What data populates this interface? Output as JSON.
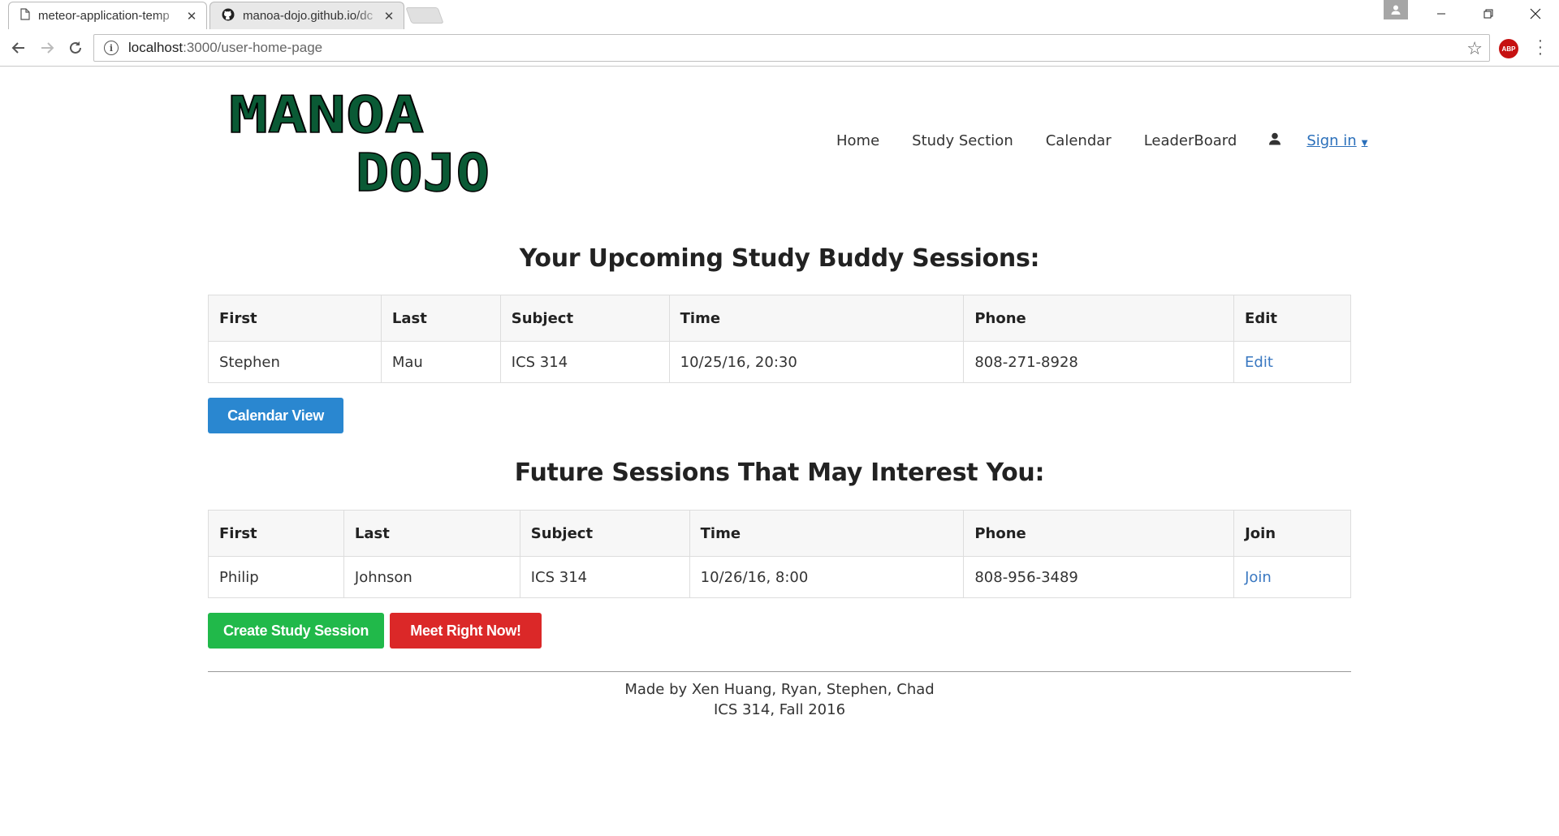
{
  "browser": {
    "tabs": [
      {
        "title": "meteor-application-temp",
        "icon": "page-icon",
        "active": true
      },
      {
        "title": "manoa-dojo.github.io/dc",
        "icon": "github-icon",
        "active": false
      }
    ],
    "url": {
      "host": "localhost",
      "path": ":3000/user-home-page"
    }
  },
  "header": {
    "logo": {
      "line1": "MANOA",
      "line2": "DOJO",
      "color": "#0a5a35"
    },
    "nav": {
      "home": "Home",
      "study_section": "Study Section",
      "calendar": "Calendar",
      "leaderboard": "LeaderBoard",
      "signin": "Sign in"
    }
  },
  "upcoming": {
    "title": "Your Upcoming Study Buddy Sessions:",
    "columns": [
      "First",
      "Last",
      "Subject",
      "Time",
      "Phone",
      "Edit"
    ],
    "rows": [
      {
        "first": "Stephen",
        "last": "Mau",
        "subject": "ICS 314",
        "time": "10/25/16, 20:30",
        "phone": "808-271-8928",
        "action": "Edit"
      }
    ],
    "button": "Calendar View"
  },
  "future": {
    "title": "Future Sessions That May Interest You:",
    "columns": [
      "First",
      "Last",
      "Subject",
      "Time",
      "Phone",
      "Join"
    ],
    "rows": [
      {
        "first": "Philip",
        "last": "Johnson",
        "subject": "ICS 314",
        "time": "10/26/16, 8:00",
        "phone": "808-956-3489",
        "action": "Join"
      }
    ],
    "create_button": "Create Study Session",
    "meet_button": "Meet Right Now!"
  },
  "footer": {
    "line1": "Made by Xen Huang, Ryan, Stephen, Chad",
    "line2": "ICS 314, Fall 2016"
  },
  "colors": {
    "logo_green": "#0a5a35",
    "link_blue": "#3a78c1",
    "button_blue": "#2a87d0",
    "button_green": "#21b94a",
    "button_red": "#db2828"
  }
}
